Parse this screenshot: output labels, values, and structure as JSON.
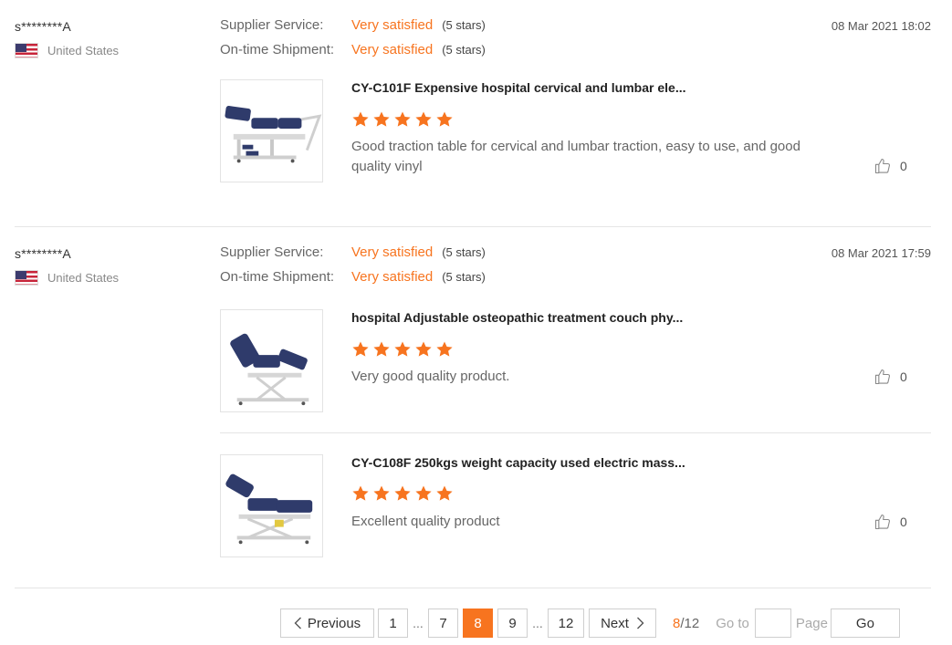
{
  "colors": {
    "accent": "#f7741f",
    "star": "#f7741f",
    "divider": "#e5e5e5"
  },
  "reviews": [
    {
      "buyer": "s********A",
      "country": "United States",
      "date": "08 Mar 2021 18:02",
      "supplier_label": "Supplier Service:",
      "supplier_value": "Very satisfied",
      "supplier_stars": "(5 stars)",
      "shipment_label": "On-time Shipment:",
      "shipment_value": "Very satisfied",
      "shipment_stars": "(5 stars)",
      "products": [
        {
          "title": "CY-C101F Expensive hospital cervical and lumbar ele...",
          "rating": 5,
          "text": "Good traction table for cervical and lumbar traction, easy to use, and good quality vinyl",
          "likes": "0",
          "image": "traction-table-image"
        }
      ]
    },
    {
      "buyer": "s********A",
      "country": "United States",
      "date": "08 Mar 2021 17:59",
      "supplier_label": "Supplier Service:",
      "supplier_value": "Very satisfied",
      "supplier_stars": "(5 stars)",
      "shipment_label": "On-time Shipment:",
      "shipment_value": "Very satisfied",
      "shipment_stars": "(5 stars)",
      "products": [
        {
          "title": "hospital Adjustable osteopathic treatment couch phy...",
          "rating": 5,
          "text": "Very good quality product.",
          "likes": "0",
          "image": "treatment-couch-image"
        },
        {
          "title": "CY-C108F 250kgs weight capacity used electric mass...",
          "rating": 5,
          "text": "Excellent quality product",
          "likes": "0",
          "image": "massage-table-image"
        }
      ]
    }
  ],
  "pagination": {
    "prev_label": "Previous",
    "next_label": "Next",
    "pages": [
      "1",
      "7",
      "8",
      "9",
      "12"
    ],
    "ellipsis": "...",
    "current": "8",
    "total": "12",
    "count_sep": "/",
    "goto_label": "Go to",
    "goto_value": "",
    "page_label": "Page",
    "go_label": "Go"
  }
}
